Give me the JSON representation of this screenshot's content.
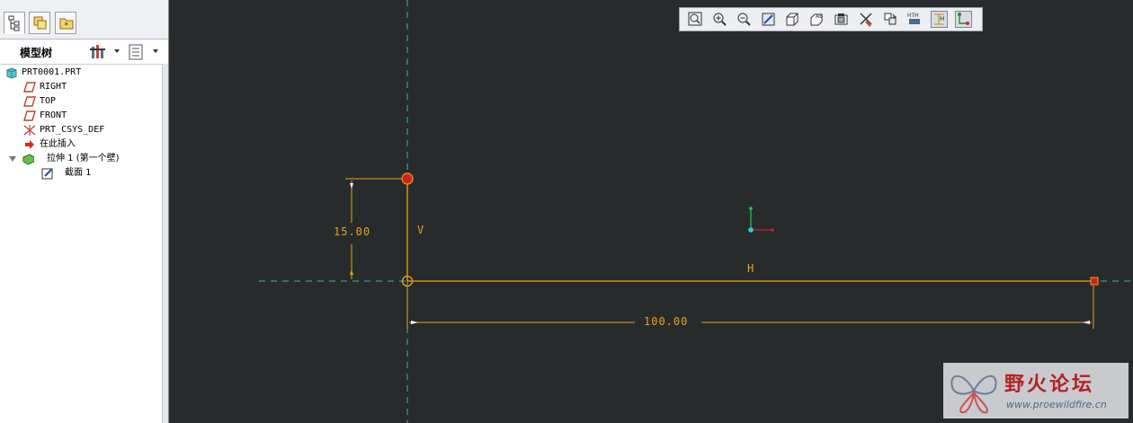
{
  "colors": {
    "canvas": "#282b2c",
    "dimension": "#e9a21a",
    "centerline": "#39b3b3",
    "vertex": "#cc2222"
  },
  "left_panel": {
    "tabs": [
      {
        "icon": "model-tree-tab-icon"
      },
      {
        "icon": "folder-browser-tab-icon"
      },
      {
        "icon": "favorites-tab-icon"
      }
    ],
    "header": {
      "title": "模型树",
      "settings_icon": "tree-settings-icon",
      "show_icon": "tree-show-icon"
    },
    "tree": {
      "items": [
        {
          "label": "PRT0001.PRT",
          "icon": "part-icon"
        },
        {
          "label": "RIGHT",
          "icon": "datum-plane-icon"
        },
        {
          "label": "TOP",
          "icon": "datum-plane-icon"
        },
        {
          "label": "FRONT",
          "icon": "datum-plane-icon"
        },
        {
          "label": "PRT_CSYS_DEF",
          "icon": "coordinate-system-icon"
        },
        {
          "label": "在此插入",
          "icon": "insert-here-arrow-icon"
        },
        {
          "label": "拉伸 1 (第一个壁)",
          "icon": "extrude-feature-icon"
        },
        {
          "label": "截面 1",
          "icon": "sketch-section-icon"
        }
      ]
    }
  },
  "graphics": {
    "toolbar": {
      "buttons": [
        {
          "icon": "refit-icon"
        },
        {
          "icon": "zoom-in-icon"
        },
        {
          "icon": "zoom-out-icon"
        },
        {
          "icon": "repaint-icon"
        },
        {
          "icon": "display-style-icon"
        },
        {
          "icon": "saved-views-icon"
        },
        {
          "icon": "sketch-orientation-icon"
        },
        {
          "icon": "disp-constraints-icon"
        },
        {
          "icon": "disp-grid-icon"
        },
        {
          "icon": "disp-dimensions-icon"
        },
        {
          "icon": "disp-vertices-icon"
        },
        {
          "icon": "disp-locks-icon"
        }
      ]
    },
    "sketch": {
      "dim_vertical": "15.00",
      "dim_horizontal": "100.00",
      "label_v": "V",
      "label_h": "H"
    }
  },
  "watermark": {
    "brand": "野火论坛",
    "url": "www.proewildfire.cn"
  }
}
